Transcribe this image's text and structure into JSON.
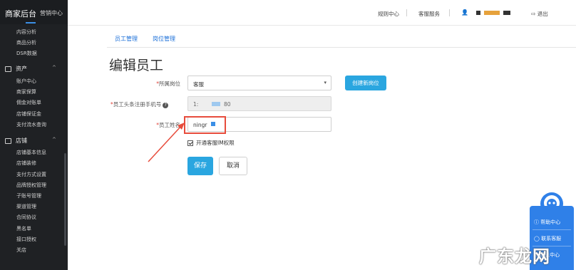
{
  "sidebar": {
    "brand_title": "商家后台",
    "brand_subtitle": "营销中心",
    "top_items": [
      "内容分析",
      "商品分析",
      "DSR数据"
    ],
    "groups": [
      {
        "label": "资产",
        "items": [
          "账户中心",
          "商家保算",
          "佣金对账单",
          "店铺保证金",
          "支付流水查询"
        ]
      },
      {
        "label": "店铺",
        "items": [
          "店铺基本信息",
          "店铺装修",
          "支付方式设置",
          "品牌授权管理",
          "子账号管理",
          "渠道管理",
          "合同协议",
          "黑名单",
          "接口授权",
          "关店"
        ]
      }
    ]
  },
  "topbar": {
    "links": [
      "规则中心",
      "客服服务"
    ],
    "user_icon": "user-icon",
    "logout": "退出",
    "logout_icon": "logout-icon"
  },
  "tabs": [
    "员工管理",
    "岗位管理"
  ],
  "page_title": "编辑员工",
  "form": {
    "position_label": "所属岗位",
    "position_value": "客服",
    "create_position_button": "创建新岗位",
    "phone_label": "员工头条注册手机号",
    "phone_prefix": "1:",
    "phone_suffix": "80",
    "name_label": "员工姓名",
    "name_value": "ningr",
    "im_checkbox_label": "开通客服IM权限",
    "im_checked": true,
    "save_button": "保存",
    "cancel_button": "取消"
  },
  "float_widget": {
    "items": [
      "帮助中心",
      "联系客服",
      "消息中心"
    ],
    "accent": "#2f80e8"
  },
  "watermark": "广东龙网",
  "colors": {
    "sidebar_bg": "#1f2124",
    "primary_button": "#2aa6e0",
    "link": "#1b6fd8",
    "highlight_box": "#e74c3c"
  }
}
